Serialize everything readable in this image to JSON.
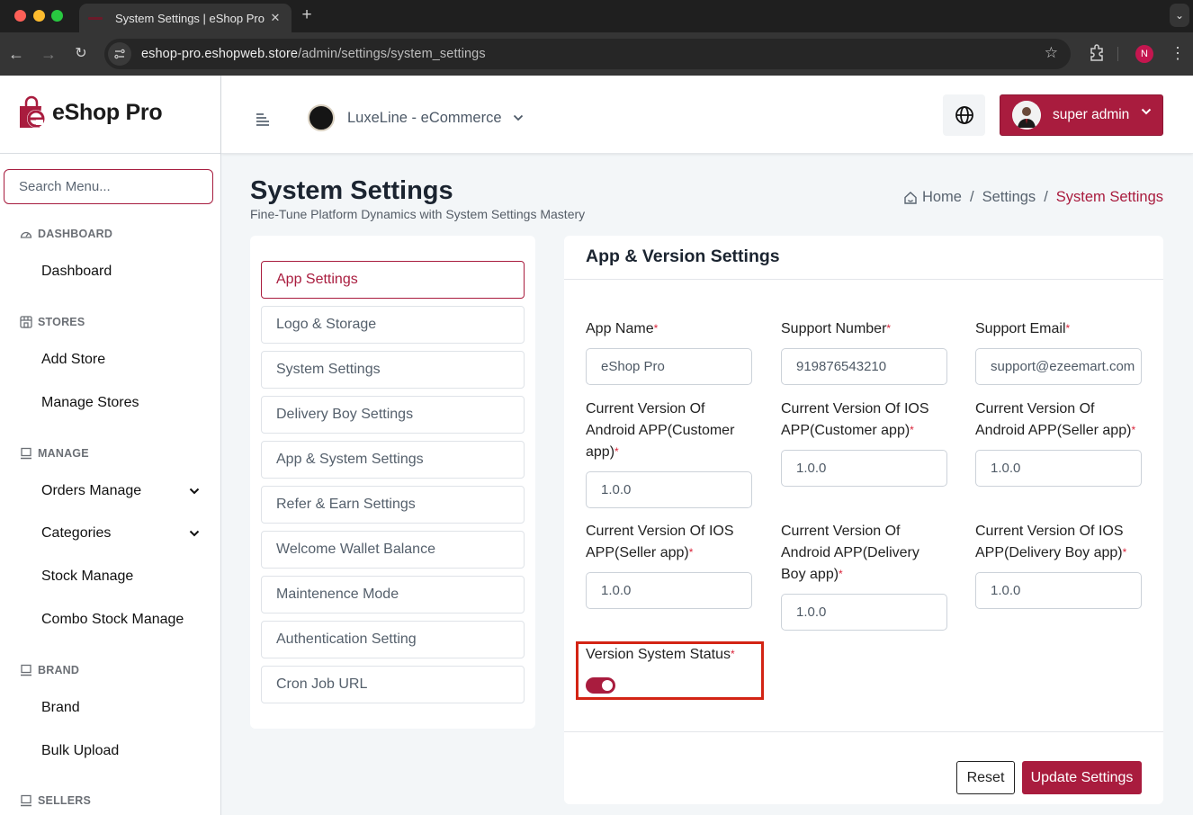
{
  "browser": {
    "tab_title": "System Settings | eShop Pro",
    "url_host": "eshop-pro.eshopweb.store",
    "url_path": "/admin/settings/system_settings",
    "profile_initial": "N"
  },
  "sidebar": {
    "logo_text": "eShop Pro",
    "search_placeholder": "Search Menu...",
    "sections": [
      {
        "title": "DASHBOARD",
        "icon": "gauge-icon",
        "items": [
          {
            "label": "Dashboard"
          }
        ]
      },
      {
        "title": "STORES",
        "icon": "store-icon",
        "items": [
          {
            "label": "Add Store"
          },
          {
            "label": "Manage Stores"
          }
        ]
      },
      {
        "title": "MANAGE",
        "icon": "laptop-icon",
        "items": [
          {
            "label": "Orders Manage",
            "expandable": true
          },
          {
            "label": "Categories",
            "expandable": true
          },
          {
            "label": "Stock Manage"
          },
          {
            "label": "Combo Stock Manage"
          }
        ]
      },
      {
        "title": "BRAND",
        "icon": "laptop-icon",
        "items": [
          {
            "label": "Brand"
          },
          {
            "label": "Bulk Upload"
          }
        ]
      },
      {
        "title": "SELLERS",
        "icon": "laptop-icon",
        "items": []
      }
    ]
  },
  "topbar": {
    "store_name": "LuxeLine - eCommerce",
    "user_name": "super admin"
  },
  "page": {
    "title": "System Settings",
    "subtitle": "Fine-Tune Platform Dynamics with System Settings Mastery",
    "breadcrumb": [
      "Home",
      "Settings",
      "System Settings"
    ]
  },
  "settings_tabs": [
    {
      "label": "App Settings",
      "active": true
    },
    {
      "label": "Logo & Storage"
    },
    {
      "label": "System Settings"
    },
    {
      "label": "Delivery Boy Settings"
    },
    {
      "label": "App & System Settings"
    },
    {
      "label": "Refer & Earn Settings"
    },
    {
      "label": "Welcome Wallet Balance"
    },
    {
      "label": "Maintenence Mode"
    },
    {
      "label": "Authentication Setting"
    },
    {
      "label": "Cron Job URL"
    }
  ],
  "form": {
    "title": "App & Version Settings",
    "fields": [
      {
        "label": "App Name",
        "value": "eShop Pro"
      },
      {
        "label": "Support Number",
        "value": "919876543210"
      },
      {
        "label": "Support Email",
        "value": "support@ezeemart.com"
      },
      {
        "label": "Current Version Of Android APP(Customer app)",
        "value": "1.0.0"
      },
      {
        "label": "Current Version Of IOS APP(Customer app)",
        "value": "1.0.0"
      },
      {
        "label": "Current Version Of Android APP(Seller app)",
        "value": "1.0.0"
      },
      {
        "label": "Current Version Of IOS APP(Seller app)",
        "value": "1.0.0"
      },
      {
        "label": "Current Version Of Android APP(Delivery Boy app)",
        "value": "1.0.0"
      },
      {
        "label": "Current Version Of IOS APP(Delivery Boy app)",
        "value": "1.0.0"
      }
    ],
    "version_status_label": "Version System Status",
    "version_status_on": true,
    "required_mark": "*",
    "reset_label": "Reset",
    "update_label": "Update Settings"
  },
  "colors": {
    "brand": "#a91c3e",
    "highlight_box": "#d32414"
  }
}
